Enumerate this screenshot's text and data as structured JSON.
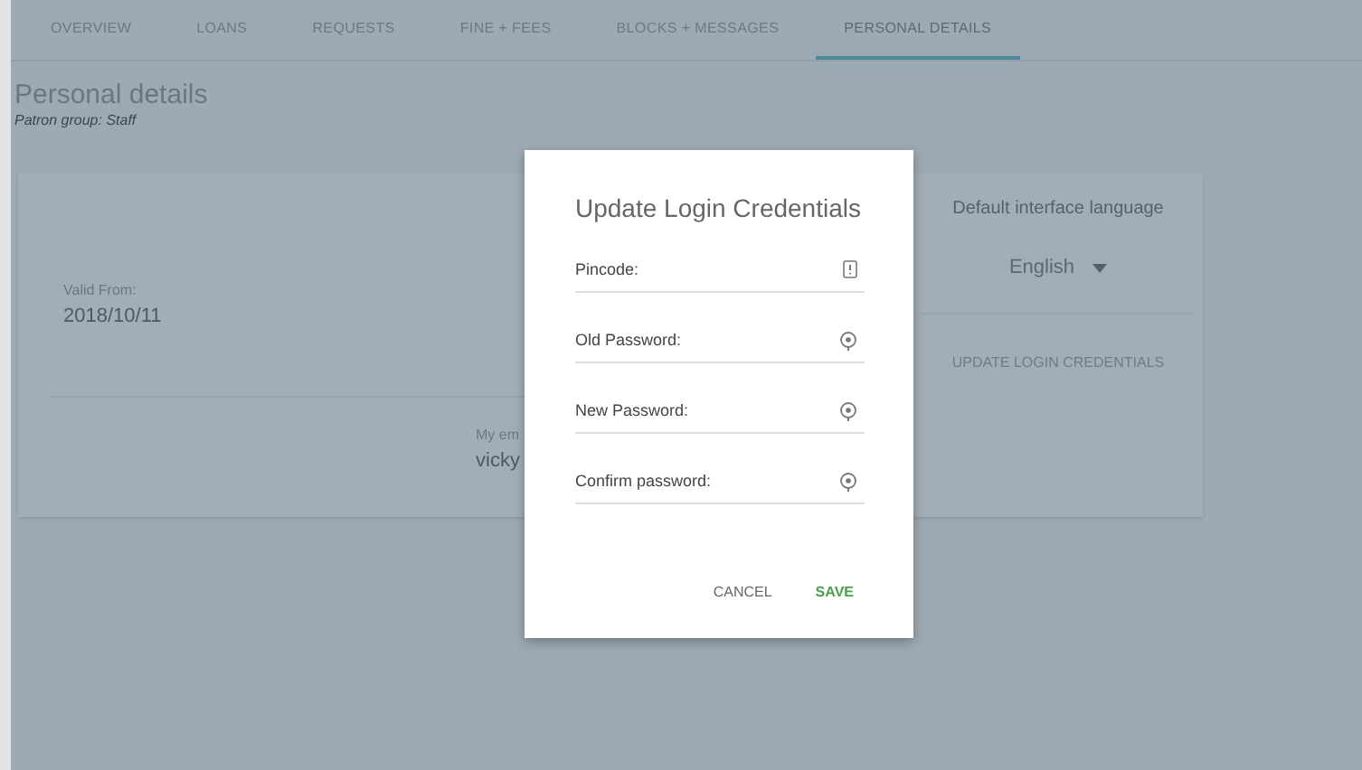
{
  "tabs": [
    {
      "label": "OVERVIEW",
      "selected": false
    },
    {
      "label": "LOANS",
      "selected": false
    },
    {
      "label": "REQUESTS",
      "selected": false
    },
    {
      "label": "FINE + FEES",
      "selected": false
    },
    {
      "label": "BLOCKS + MESSAGES",
      "selected": false
    },
    {
      "label": "PERSONAL DETAILS",
      "selected": true
    }
  ],
  "page": {
    "title": "Personal details",
    "subtitle": "Patron group: Staff"
  },
  "card": {
    "valid_from_label": "Valid From:",
    "valid_from": "2018/10/11",
    "email_label": "My em",
    "email": "vicky",
    "language_label": "Default interface language",
    "language": "English",
    "update_link": "UPDATE LOGIN CREDENTIALS"
  },
  "dialog": {
    "title": "Update Login Credentials",
    "fields": [
      {
        "label": "Pincode:",
        "kind": "pin"
      },
      {
        "label": "Old Password:",
        "kind": "password"
      },
      {
        "label": "New Password:",
        "kind": "password"
      },
      {
        "label": "Confirm password:",
        "kind": "password"
      }
    ],
    "cancel": "CANCEL",
    "save": "SAVE"
  }
}
